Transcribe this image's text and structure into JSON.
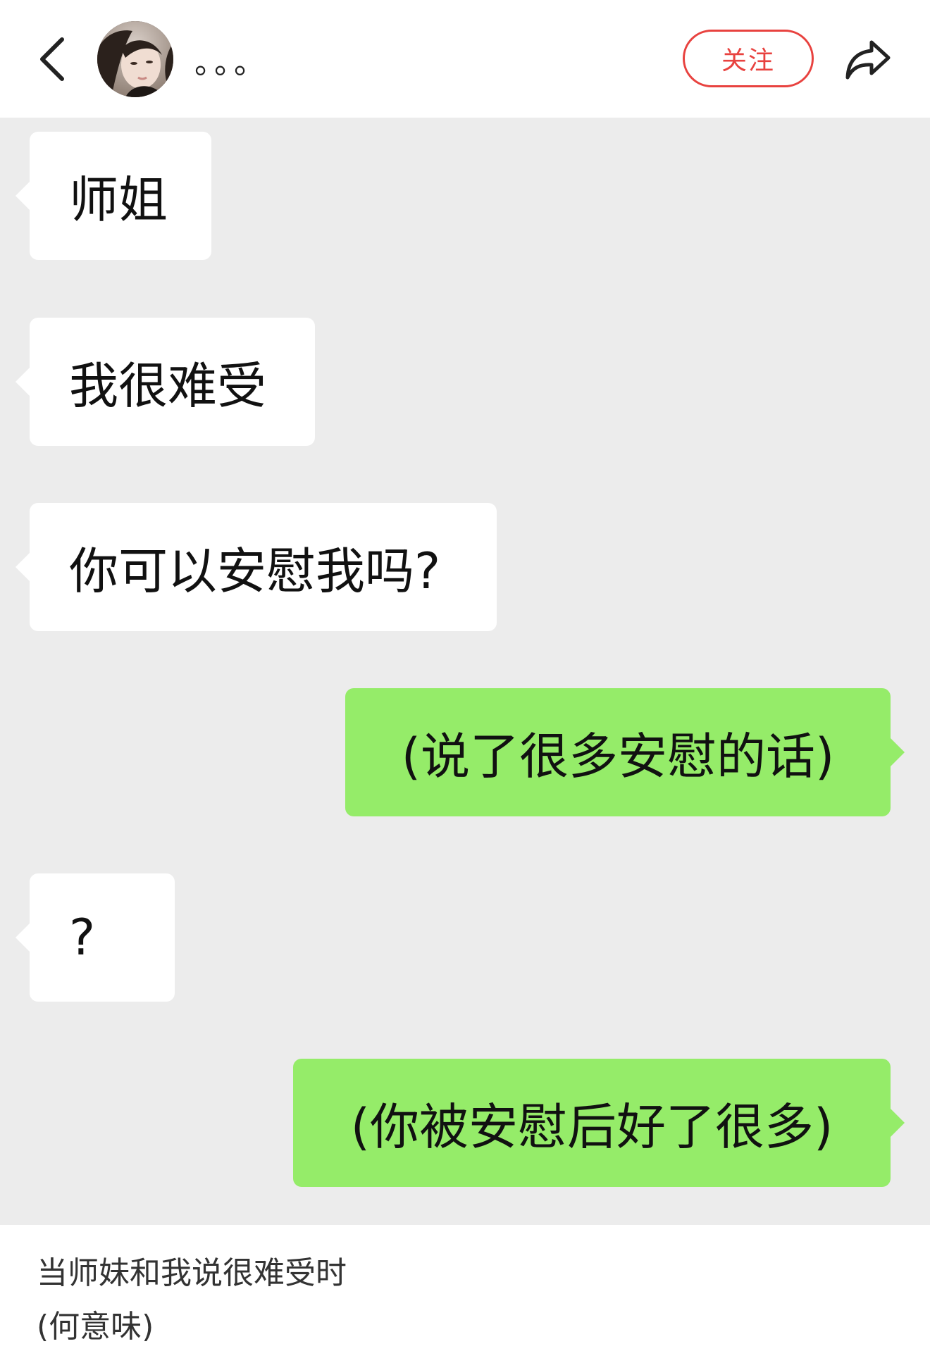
{
  "header": {
    "back_icon": "chevron-left-icon",
    "avatar_description": "profile-photo",
    "username": "。。。",
    "follow_label": "关注",
    "share_icon": "share-arrow-icon",
    "accent_color": "#e8423f"
  },
  "chat": {
    "background": "#ececec",
    "incoming_color": "#ffffff",
    "outgoing_color": "#95ec69",
    "messages": [
      {
        "side": "in",
        "text": "师姐"
      },
      {
        "side": "in",
        "text": "我很难受"
      },
      {
        "side": "in",
        "text": "你可以安慰我吗?"
      },
      {
        "side": "out",
        "text": "(说了很多安慰的话)"
      },
      {
        "side": "in",
        "text": "?"
      },
      {
        "side": "out",
        "text": "(你被安慰后好了很多)"
      }
    ]
  },
  "caption": {
    "line1": "当师妹和我说很难受时",
    "line2": "(何意味)"
  }
}
